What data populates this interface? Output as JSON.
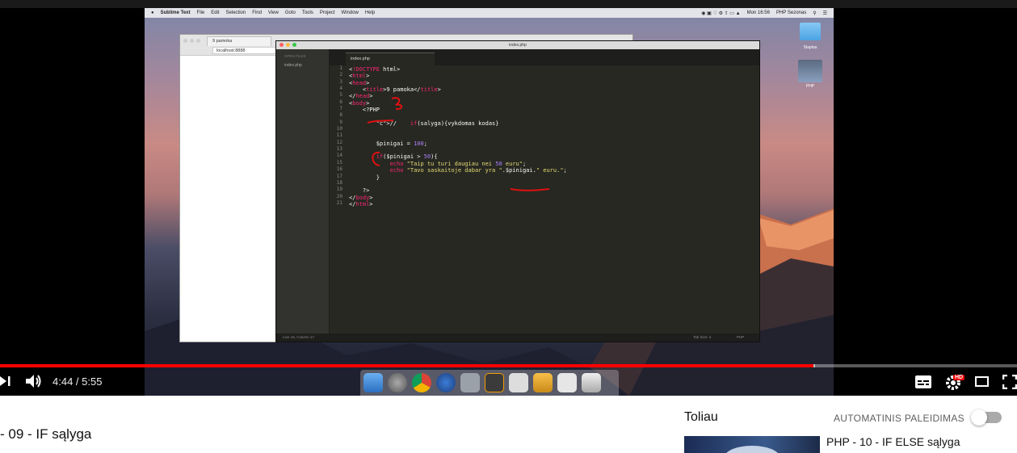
{
  "mac_menu": {
    "app_name": "Sublime Text",
    "items": [
      "File",
      "Edit",
      "Selection",
      "Find",
      "View",
      "Goto",
      "Tools",
      "Project",
      "Window",
      "Help"
    ],
    "clock": "Mon 16:56",
    "user": "PHP Sezonas"
  },
  "browser": {
    "tab_title": "9 pamoka",
    "url": "localhost:8888"
  },
  "sublime": {
    "window_title": "index.php",
    "sidebar_header": "OPEN FILES",
    "sidebar_file": "index.php",
    "tab_label": "index.php",
    "status_left": "Line 16, Column 17",
    "status_tab": "Tab Size: 4",
    "status_syntax": "PHP",
    "code_lines": [
      "<!DOCTYPE html>",
      "<html>",
      "<head>",
      "    <title>9 pamoka</title>",
      "</head>",
      "<body>",
      "    <?PHP",
      "",
      "        //    if(salyga){vykdomas kodas}",
      "",
      "",
      "        $pinigai = 100;",
      "",
      "        if($pinigai > 50){",
      "            echo \"Taip tu turi daugiau nei 50 euru\";",
      "            echo \"Tavo saskaitoje dabar yra \".$pinigai.\" euru.\";",
      "        }",
      "",
      "    ?>",
      "</body>",
      "</html>"
    ]
  },
  "desktop_icons": [
    {
      "label": "Slaptas"
    },
    {
      "label": "PHP"
    }
  ],
  "player": {
    "time": "4:44 / 5:55",
    "progress_fraction": 0.8,
    "hd_badge": "HD"
  },
  "page": {
    "video_title": "- 09 - IF sąlyga",
    "up_next_label": "Toliau",
    "autoplay_label": "AUTOMATINIS PALEIDIMAS",
    "next_video_title": "PHP - 10 - IF ELSE sąlyga"
  }
}
